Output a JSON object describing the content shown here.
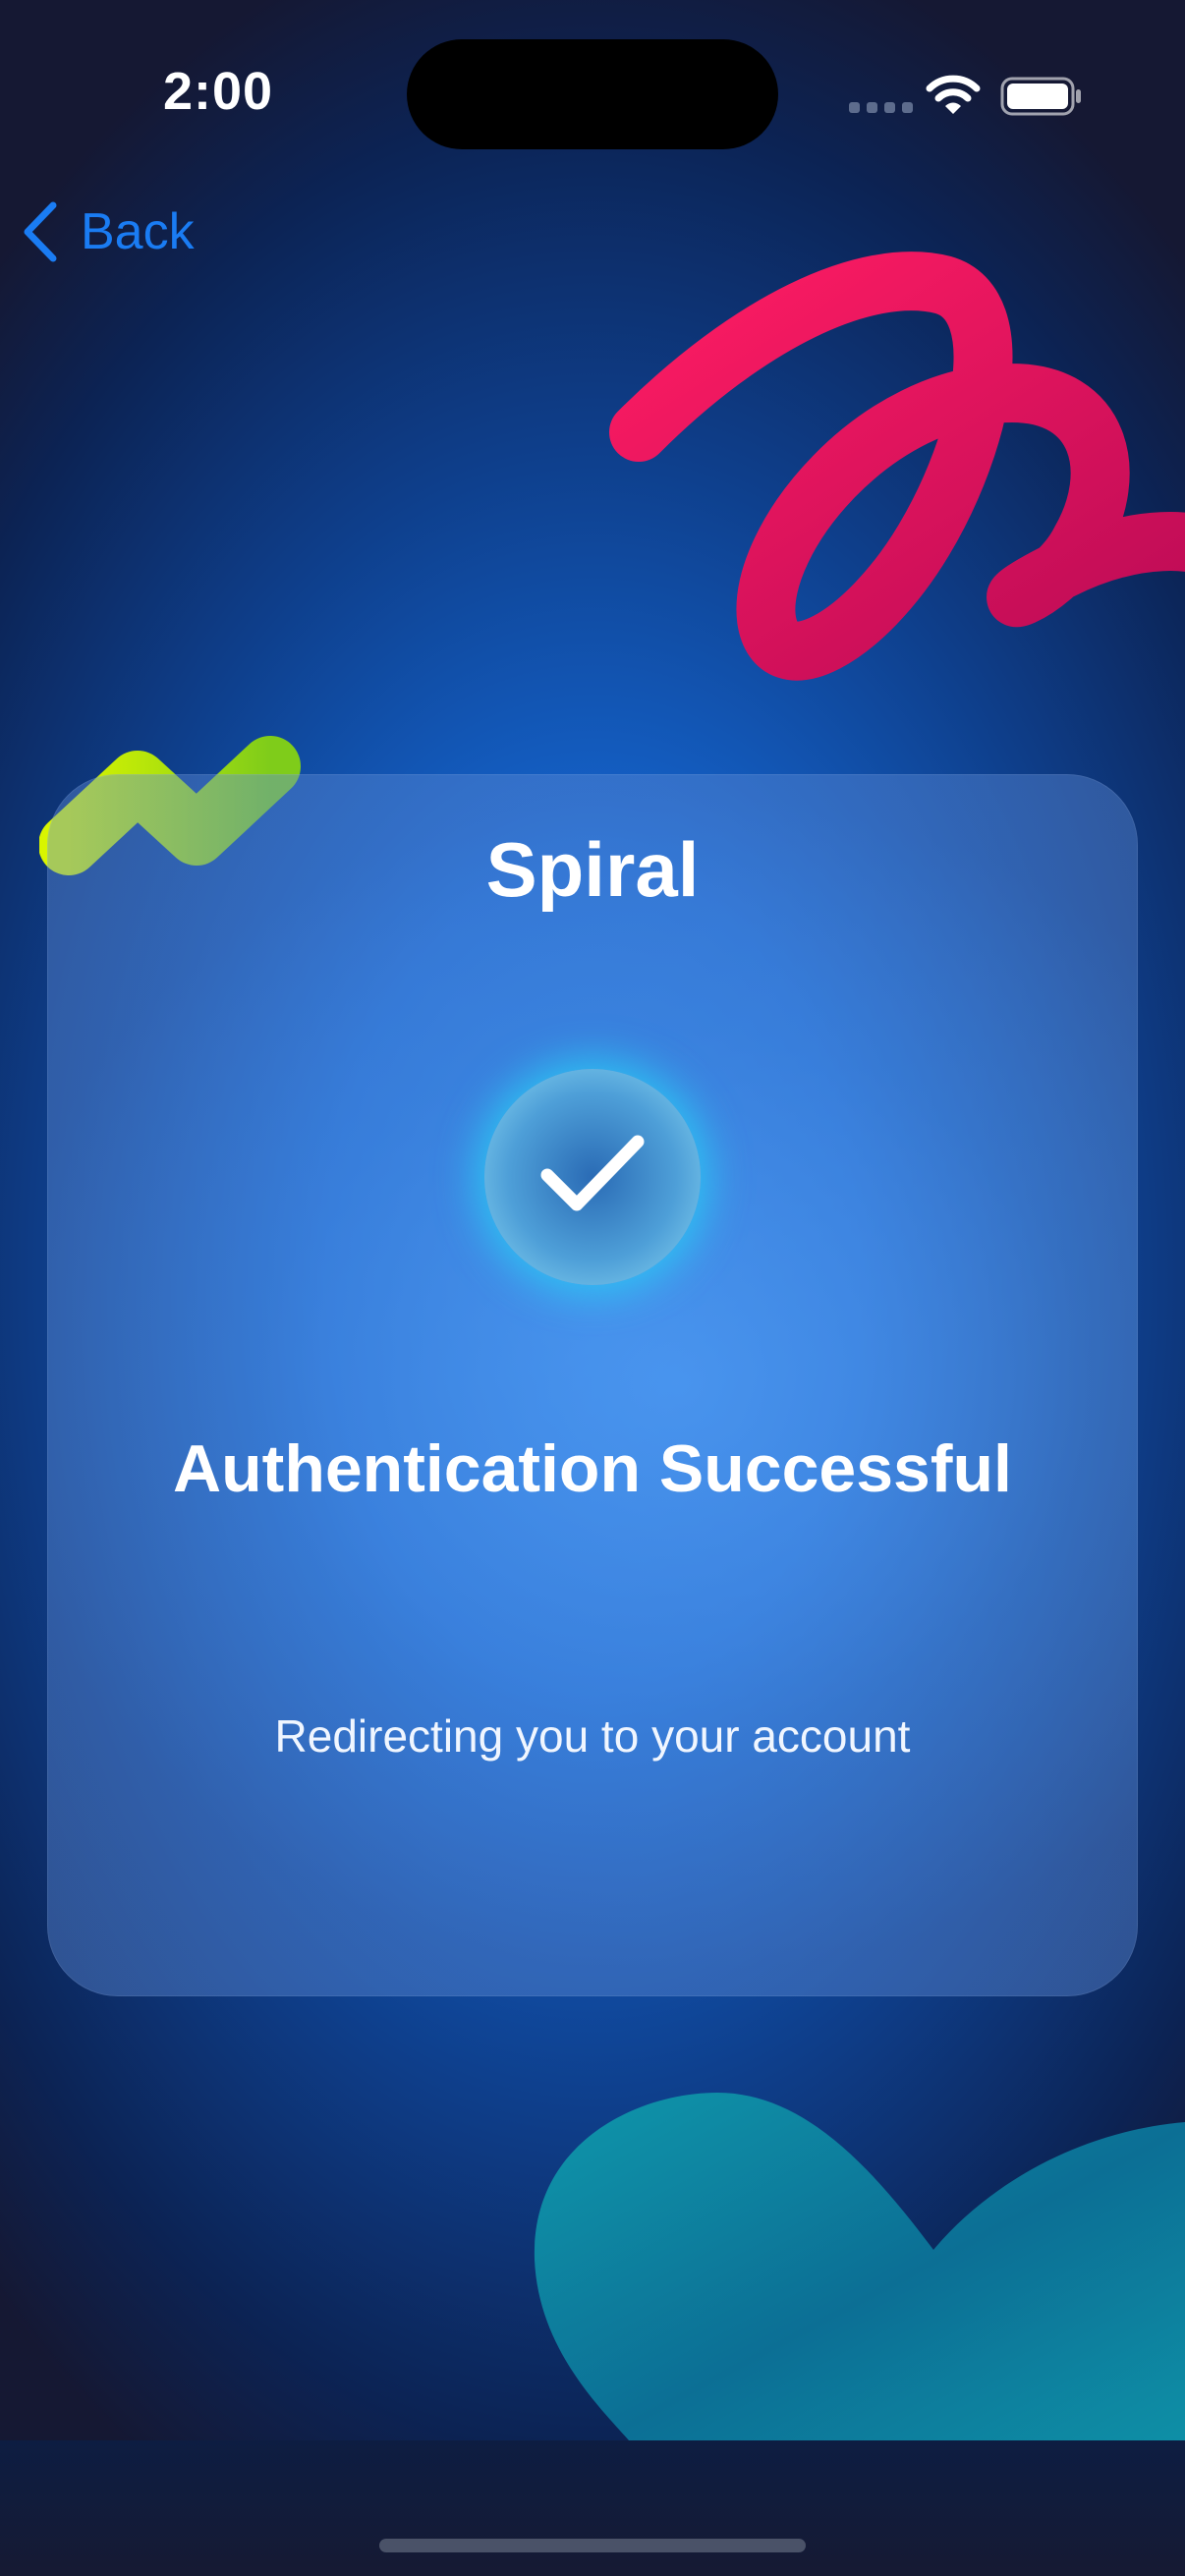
{
  "status_bar": {
    "time": "2:00"
  },
  "nav": {
    "back_label": "Back"
  },
  "card": {
    "title": "Spiral",
    "heading": "Authentication Successful",
    "subtext": "Redirecting you to your account"
  },
  "icons": {
    "back": "chevron-left-icon",
    "wifi": "wifi-icon",
    "battery": "battery-icon",
    "check": "checkmark-icon"
  },
  "colors": {
    "accent": "#1a7cf3",
    "ribbon": "#e8115a",
    "zigzag": "#b8ee1a",
    "blob": "#0f8fa6",
    "badge_glow": "#28d2f5"
  }
}
